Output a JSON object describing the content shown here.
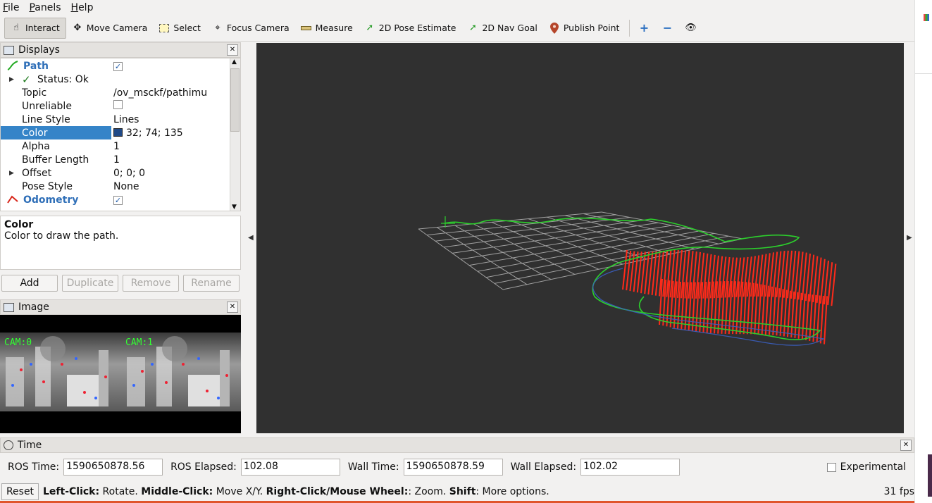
{
  "menu": [
    "File",
    "Panels",
    "Help"
  ],
  "toolbar": {
    "interact": "Interact",
    "move_camera": "Move Camera",
    "select": "Select",
    "focus_camera": "Focus Camera",
    "measure": "Measure",
    "pose_estimate": "2D Pose Estimate",
    "nav_goal": "2D Nav Goal",
    "publish_point": "Publish Point"
  },
  "displays": {
    "title": "Displays",
    "rows": [
      {
        "name": "Path",
        "value": "✓"
      },
      {
        "name": "Status: Ok",
        "value": ""
      },
      {
        "name": "Topic",
        "value": "/ov_msckf/pathimu"
      },
      {
        "name": "Unreliable",
        "value": ""
      },
      {
        "name": "Line Style",
        "value": "Lines"
      },
      {
        "name": "Color",
        "value": "32; 74; 135"
      },
      {
        "name": "Alpha",
        "value": "1"
      },
      {
        "name": "Buffer Length",
        "value": "1"
      },
      {
        "name": "Offset",
        "value": "0; 0; 0"
      },
      {
        "name": "Pose Style",
        "value": "None"
      },
      {
        "name": "Odometry",
        "value": "✓"
      }
    ],
    "path_color": "#204a87"
  },
  "description": {
    "title": "Color",
    "text": "Color to draw the path."
  },
  "buttons": {
    "add": "Add",
    "duplicate": "Duplicate",
    "remove": "Remove",
    "rename": "Rename"
  },
  "image_panel": {
    "title": "Image",
    "cam0": "CAM:0",
    "cam1": "CAM:1"
  },
  "time": {
    "title": "Time",
    "ros_time_label": "ROS Time:",
    "ros_time": "1590650878.56",
    "ros_elapsed_label": "ROS Elapsed:",
    "ros_elapsed": "102.08",
    "wall_time_label": "Wall Time:",
    "wall_time": "1590650878.59",
    "wall_elapsed_label": "Wall Elapsed:",
    "wall_elapsed": "102.02",
    "experimental": "Experimental"
  },
  "status": {
    "reset": "Reset",
    "lc": "Left-Click:",
    "lc_text": " Rotate. ",
    "mc": "Middle-Click:",
    "mc_text": " Move X/Y. ",
    "rc": "Right-Click/Mouse Wheel:",
    "rc_text": ": Zoom. ",
    "shift": "Shift",
    "shift_text": ": More options.",
    "fps": "31 fps"
  },
  "colors": {
    "selection": "#3584c8",
    "background_3d": "#303030",
    "odometry_arrows": "#ff2a1a",
    "path_green": "#22cc22"
  }
}
